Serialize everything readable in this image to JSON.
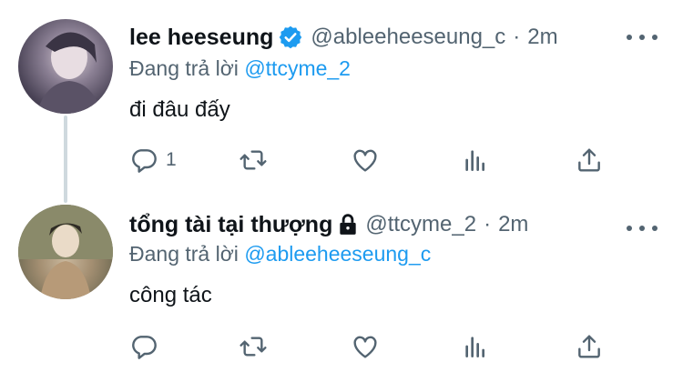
{
  "colors": {
    "accent": "#1d9bf0",
    "secondary_text": "#536471",
    "primary_text": "#0f1419",
    "thread_line": "#cfd9de"
  },
  "tweets": [
    {
      "display_name": "lee heeseung",
      "badge": "verified-badge-icon",
      "handle": "@ableeheeseung_c",
      "separator": "·",
      "time": "2m",
      "reply_prefix": "Đang trả lời",
      "reply_mention": "@ttcyme_2",
      "text": "đi đâu đấy",
      "reply_count": "1"
    },
    {
      "display_name": "tổng tài tại thượng",
      "badge": "lock-icon",
      "handle": "@ttcyme_2",
      "separator": "·",
      "time": "2m",
      "reply_prefix": "Đang trả lời",
      "reply_mention": "@ableeheeseung_c",
      "text": "công tác",
      "reply_count": ""
    }
  ]
}
